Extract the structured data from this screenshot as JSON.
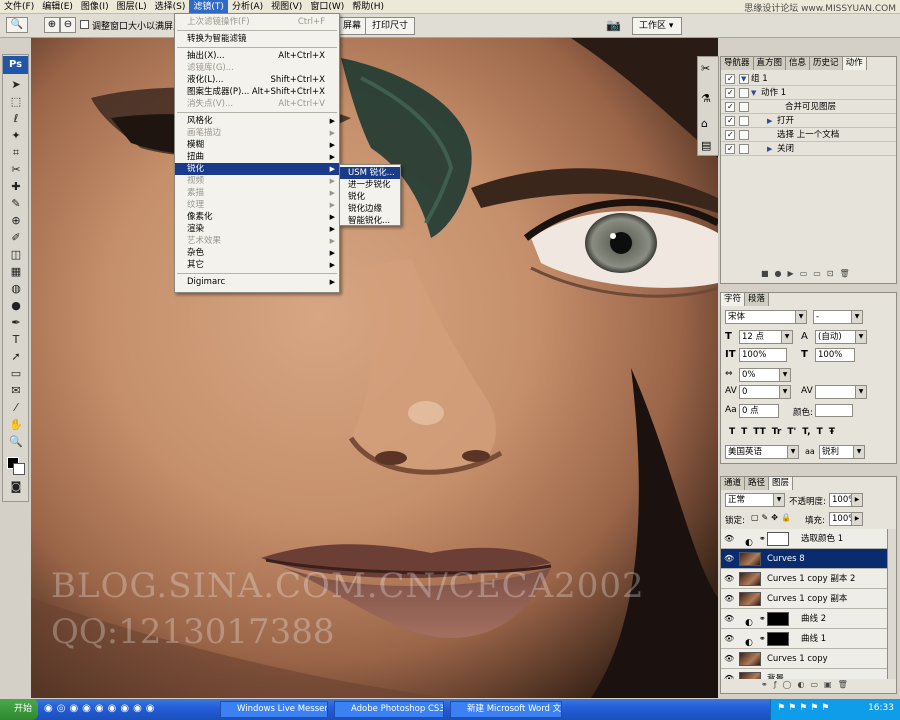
{
  "menubar": {
    "items": [
      "文件(F)",
      "编辑(E)",
      "图像(I)",
      "图层(L)",
      "选择(S)",
      "滤镜(T)",
      "分析(A)",
      "视图(V)",
      "窗口(W)",
      "帮助(H)"
    ],
    "active_index": 5
  },
  "site_watermark": "思缘设计论坛 www.MISSYUAN.COM",
  "optionsbar": {
    "checkbox_label": "调整窗口大小以满屏显",
    "full_screen_button": "屏幕",
    "print_size_button": "打印尺寸",
    "workspace_label": "工作区"
  },
  "filter_menu": {
    "items": [
      {
        "label": "上次滤镜操作(F)",
        "shortcut": "Ctrl+F",
        "disabled": true
      },
      {
        "label": "转换为智能滤镜",
        "shortcut": "",
        "disabled": false,
        "sep_before": true
      },
      {
        "label": "抽出(X)...",
        "shortcut": "Alt+Ctrl+X",
        "disabled": false,
        "sep_before": true
      },
      {
        "label": "滤镜库(G)...",
        "shortcut": "",
        "disabled": true
      },
      {
        "label": "液化(L)...",
        "shortcut": "Shift+Ctrl+X",
        "disabled": false
      },
      {
        "label": "图案生成器(P)...",
        "shortcut": "Alt+Shift+Ctrl+X",
        "disabled": false
      },
      {
        "label": "消失点(V)...",
        "shortcut": "Alt+Ctrl+V",
        "disabled": true
      },
      {
        "label": "风格化",
        "submenu": true,
        "disabled": false,
        "sep_before": true
      },
      {
        "label": "画笔描边",
        "submenu": true,
        "disabled": true
      },
      {
        "label": "模糊",
        "submenu": true,
        "disabled": false
      },
      {
        "label": "扭曲",
        "submenu": true,
        "disabled": false
      },
      {
        "label": "锐化",
        "submenu": true,
        "disabled": false,
        "highlighted": true
      },
      {
        "label": "视频",
        "submenu": true,
        "disabled": true
      },
      {
        "label": "素描",
        "submenu": true,
        "disabled": true
      },
      {
        "label": "纹理",
        "submenu": true,
        "disabled": true
      },
      {
        "label": "像素化",
        "submenu": true,
        "disabled": false
      },
      {
        "label": "渲染",
        "submenu": true,
        "disabled": false
      },
      {
        "label": "艺术效果",
        "submenu": true,
        "disabled": true
      },
      {
        "label": "杂色",
        "submenu": true,
        "disabled": false
      },
      {
        "label": "其它",
        "submenu": true,
        "disabled": false
      },
      {
        "label": "Digimarc",
        "submenu": true,
        "disabled": false,
        "sep_before": true
      }
    ]
  },
  "sharpen_submenu": {
    "items": [
      "USM 锐化...",
      "进一步锐化",
      "锐化",
      "锐化边缘",
      "智能锐化..."
    ],
    "highlighted_index": 0
  },
  "canvas_watermark": {
    "line1": "BLOG.SINA.COM.CN/CECA2002",
    "line2": "QQ:1213017388"
  },
  "actions_panel": {
    "tabs": [
      "导航器",
      "直方图",
      "信息",
      "历史记",
      "动作"
    ],
    "active_tab": 4,
    "rows": [
      "组 1",
      "动作 1",
      "合并可见图层",
      "打开",
      "选择 上一个文档",
      "关闭"
    ]
  },
  "character_panel": {
    "tabs": [
      "字符",
      "段落"
    ],
    "font_family": "宋体",
    "font_style": "-",
    "font_size": "12 点",
    "leading": "(自动)",
    "vertical_scale": "100%",
    "horizontal_scale": "100%",
    "tracking": "0%",
    "kerning": "0",
    "baseline_shift": "0 点",
    "color_label": "颜色:",
    "style_buttons": [
      "T",
      "T",
      "TT",
      "Tr",
      "T'",
      "T,",
      "T",
      "Ŧ"
    ],
    "language": "美国英语",
    "antialias_prefix": "aa",
    "antialias": "锐利"
  },
  "layers_panel": {
    "tabs": [
      "通道",
      "路径",
      "图层"
    ],
    "active_tab": 2,
    "blend_mode": "正常",
    "opacity_label": "不透明度:",
    "opacity": "100%",
    "lock_label": "锁定:",
    "fill_label": "填充:",
    "fill": "100%",
    "layers": [
      {
        "name": "选取颜色 1",
        "kind": "adjustment"
      },
      {
        "name": "Curves 8",
        "kind": "photo",
        "selected": true
      },
      {
        "name": "Curves 1 copy 副本 2",
        "kind": "photo"
      },
      {
        "name": "Curves 1 copy 副本",
        "kind": "photo"
      },
      {
        "name": "曲线 2",
        "kind": "adjustment"
      },
      {
        "name": "曲线 1",
        "kind": "adjustment"
      },
      {
        "name": "Curves 1 copy",
        "kind": "photo"
      },
      {
        "name": "背景",
        "kind": "photo"
      }
    ]
  },
  "taskbar": {
    "start": "开始",
    "tasks": [
      "Windows Live Messenger",
      "Adobe Photoshop CS3 E...",
      "新建 Microsoft Word 文..."
    ],
    "clock": "16:33"
  },
  "colors": {
    "menu_highlight": "#1a3a8a",
    "selected_layer": "#0a2b6e",
    "taskbar_blue": "#245edb",
    "ps_blue": "#1f56a8"
  }
}
